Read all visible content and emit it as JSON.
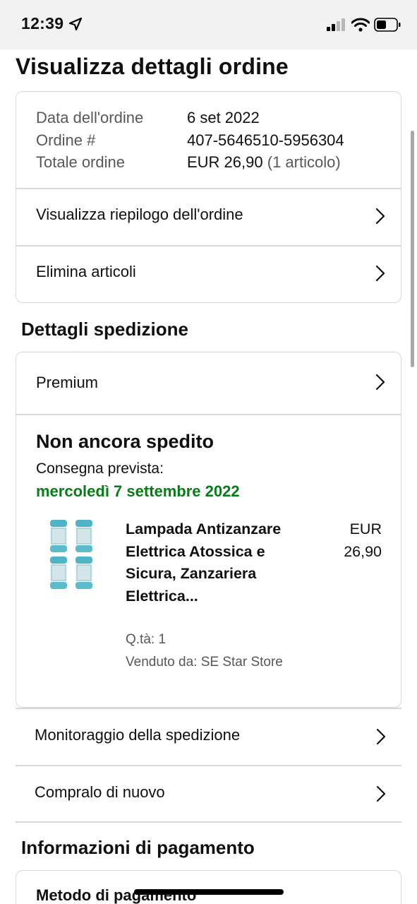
{
  "status_bar": {
    "time": "12:39"
  },
  "page_title": "Visualizza dettagli ordine",
  "order_info": {
    "date_label": "Data dell'ordine",
    "date_value": "6 set 2022",
    "order_label": "Ordine #",
    "order_value": "407-5646510-5956304",
    "total_label": "Totale ordine",
    "total_value": "EUR 26,90",
    "total_items": "(1 articolo)"
  },
  "order_actions": {
    "summary_label": "Visualizza riepilogo dell'ordine",
    "remove_label": "Elimina articoli"
  },
  "shipping": {
    "section_title": "Dettagli spedizione",
    "service_label": "Premium",
    "status": "Non ancora spedito",
    "expected_label": "Consegna prevista:",
    "expected_date": "mercoledì 7 settembre 2022",
    "product": {
      "title": "Lampada Antizanzare Elettrica Atossica e Sicura, Zanzariera Elettrica...",
      "price_currency": "EUR",
      "price_value": "26,90",
      "qty": "Q.tà: 1",
      "seller": "Venduto da: SE Star Store"
    },
    "track_label": "Monitoraggio della spedizione",
    "buy_again_label": "Compralo di nuovo"
  },
  "payment": {
    "section_title": "Informazioni di pagamento",
    "method_label": "Metodo di pagamento"
  },
  "colors": {
    "delivery_green": "#067d16",
    "border": "#d5d9d9",
    "muted_text": "#565959"
  },
  "icons": [
    "location-arrow-icon",
    "cellular-signal-icon",
    "wifi-icon",
    "battery-icon",
    "chevron-right-icon"
  ]
}
